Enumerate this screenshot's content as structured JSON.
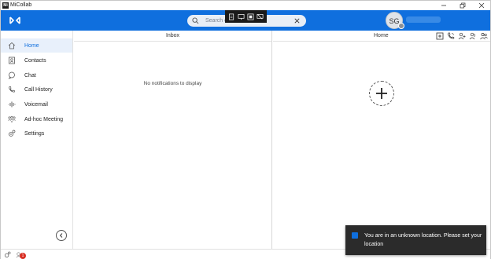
{
  "window": {
    "title": "MiCollab",
    "app_icon_text": "Mi"
  },
  "header": {
    "search_placeholder": "Search c",
    "avatar_initials": "SG"
  },
  "sidebar": {
    "items": [
      {
        "label": "Home",
        "icon": "home-icon",
        "active": true
      },
      {
        "label": "Contacts",
        "icon": "contacts-icon",
        "active": false
      },
      {
        "label": "Chat",
        "icon": "chat-icon",
        "active": false
      },
      {
        "label": "Call History",
        "icon": "call-history-icon",
        "active": false
      },
      {
        "label": "Voicemail",
        "icon": "voicemail-icon",
        "active": false
      },
      {
        "label": "Ad-hoc Meeting",
        "icon": "meeting-icon",
        "active": false
      },
      {
        "label": "Settings",
        "icon": "settings-icon",
        "active": false
      }
    ]
  },
  "inbox": {
    "title": "Inbox",
    "empty_message": "No notifications to display"
  },
  "home": {
    "title": "Home"
  },
  "bottombar": {
    "badge_count": "1"
  },
  "toast": {
    "message": "You are in an unknown location. Please set your location"
  },
  "colors": {
    "brand_blue": "#0f6fde",
    "active_bg": "#e8f0fb",
    "toast_bg": "#2b2b2b"
  }
}
